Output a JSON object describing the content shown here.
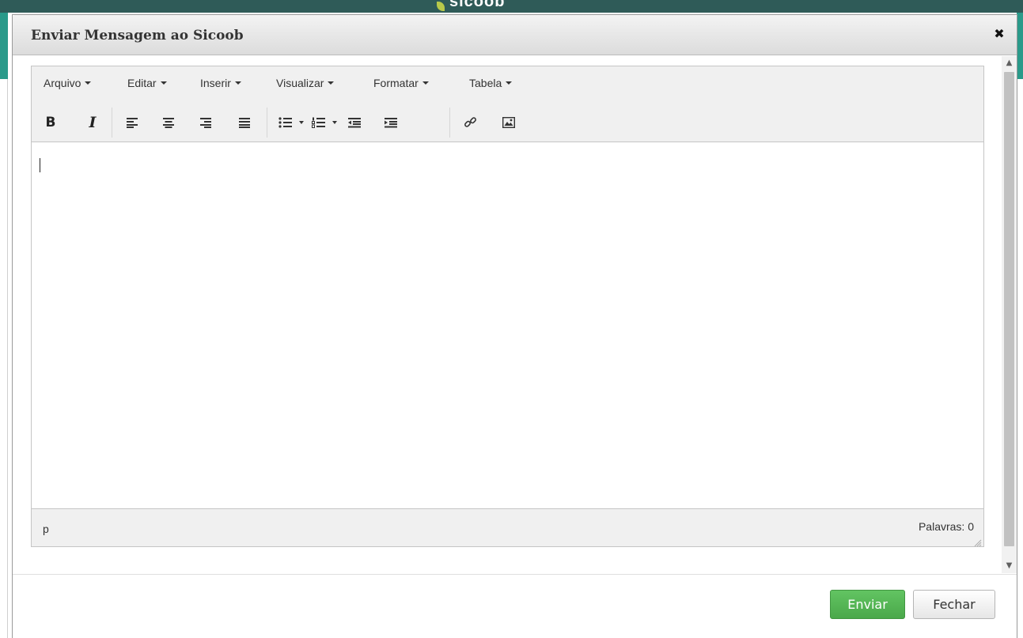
{
  "background": {
    "logo_text": "sicoob"
  },
  "dialog": {
    "title": "Enviar Mensagem ao Sicoob",
    "close_glyph": "✖"
  },
  "editor": {
    "menu": [
      {
        "label": "Arquivo"
      },
      {
        "label": "Editar"
      },
      {
        "label": "Inserir"
      },
      {
        "label": "Visualizar"
      },
      {
        "label": "Formatar"
      },
      {
        "label": "Tabela"
      }
    ],
    "toolbar": {
      "bold": "B",
      "italic": "I",
      "icons": [
        "bold-icon",
        "italic-icon",
        "align-left-icon",
        "align-center-icon",
        "align-right-icon",
        "align-justify-icon",
        "bullet-list-icon",
        "numbered-list-icon",
        "outdent-icon",
        "indent-icon",
        "link-icon",
        "image-icon"
      ]
    },
    "status": {
      "path": "p",
      "word_count": "Palavras: 0"
    }
  },
  "footer": {
    "send_label": "Enviar",
    "close_label": "Fechar"
  },
  "colors": {
    "send_button": "#5cb85c",
    "header_bar": "#2f5b58",
    "accent": "#2a9a8a"
  }
}
